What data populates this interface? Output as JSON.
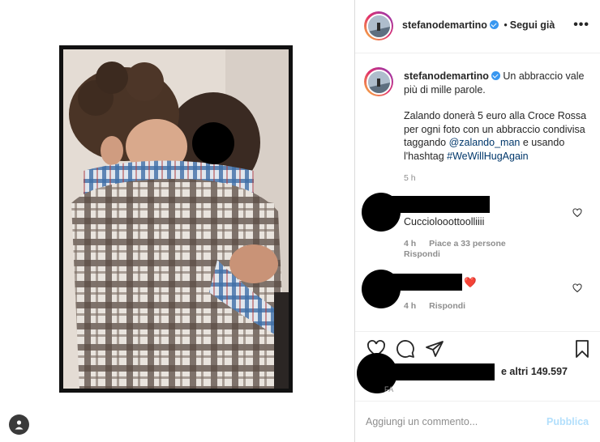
{
  "post": {
    "author": "stefanodemartino",
    "follow_state": "Segui già",
    "more": "•••"
  },
  "caption": {
    "author": "stefanodemartino",
    "line1": "Un abbraccio vale più di mille parole.",
    "line2_prefix": "Zalando donerà 5 euro alla Croce Rossa per ogni foto con un abbraccio condivisa taggando ",
    "mention": "@zalando_man",
    "line2_mid": " e usando l'hashtag ",
    "hashtag": "#WeWillHugAgain",
    "time": "5 h"
  },
  "comments": [
    {
      "text": "Cucciolooottoolliiii",
      "time": "4 h",
      "likes": "Piace a 33 persone",
      "reply": "Rispondi"
    },
    {
      "text": "❤️",
      "time": "4 h",
      "reply": "Rispondi"
    }
  ],
  "likes": {
    "text": "e altri 149.597"
  },
  "date": {
    "text": "FA"
  },
  "add_comment": {
    "placeholder": "Aggiungi un commento...",
    "publish": "Pubblica"
  },
  "colors": {
    "link": "#00376b",
    "muted": "#8e8e8e",
    "verified": "#3897f0",
    "publish_disabled": "#b2dffc"
  }
}
